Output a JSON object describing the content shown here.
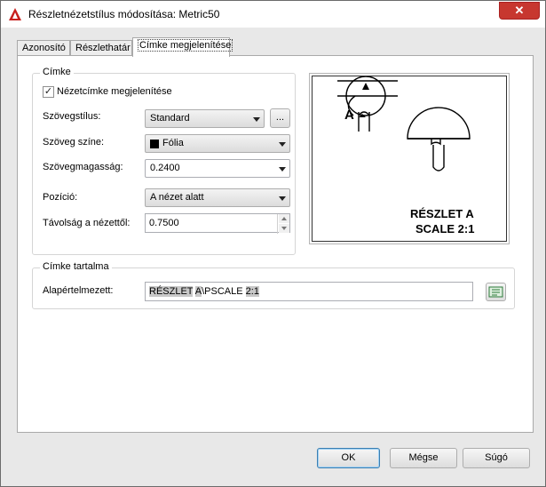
{
  "window": {
    "title": "Részletnézetstílus módosítása: Metric50",
    "close_label": "✕"
  },
  "tabs": [
    {
      "label": "Azonosító"
    },
    {
      "label": "Részlethatár"
    },
    {
      "label": "Címke megjelenítése"
    }
  ],
  "label_group": {
    "legend": "Címke",
    "show_label_checkbox": "Nézetcímke megjelenítése",
    "show_label_checked": true,
    "text_style_label": "Szövegstílus:",
    "text_style_value": "Standard",
    "browse_label": "...",
    "text_color_label": "Szöveg színe:",
    "text_color_value": "Fólia",
    "text_color_swatch": "#000000",
    "text_height_label": "Szövegmagasság:",
    "text_height_value": "0.2400",
    "position_label": "Pozíció:",
    "position_value": "A nézet alatt",
    "distance_label": "Távolság a nézettől:",
    "distance_value": "0.7500"
  },
  "preview": {
    "letter": "A",
    "caption_line1": "RÉSZLET A",
    "caption_line2": "SCALE 2:1"
  },
  "content_group": {
    "legend": "Címke tartalma",
    "default_label": "Alapértelmezett:",
    "default_parts": {
      "p1": "RÉSZLET",
      "p2": " ",
      "p3": "A",
      "p4": "\\PSCALE ",
      "p5": "2:1"
    }
  },
  "footer": {
    "ok": "OK",
    "cancel": "Mégse",
    "help": "Súgó"
  }
}
